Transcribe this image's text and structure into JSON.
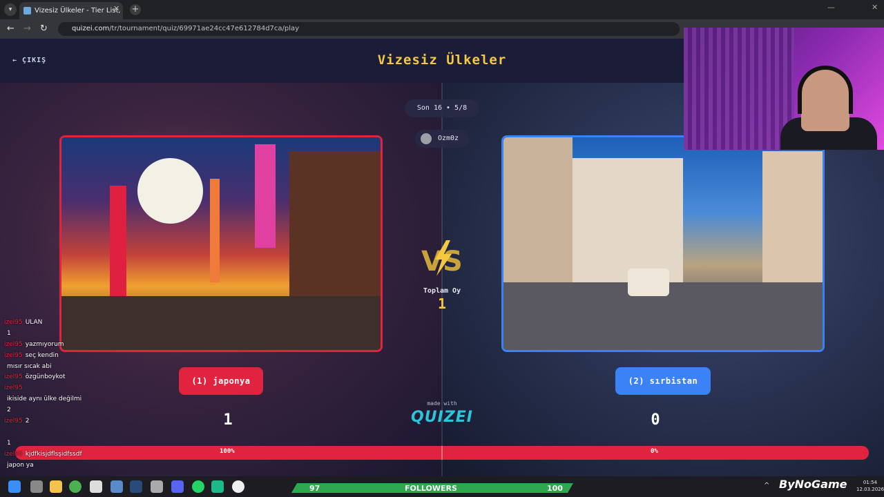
{
  "browser": {
    "tab_title": "Vizesiz Ülkeler - Tier List, Kör Se",
    "url_site": "quizei.com",
    "url_path": "/tr/tournament/quiz/69971ae24cc47e612784d7ca/play"
  },
  "header": {
    "exit_label": "ÇIKIŞ",
    "title": "Vizesiz Ülkeler"
  },
  "round": "Son 16 • 5/8",
  "user": "Ozm0z",
  "total": {
    "label": "Toplam Oy",
    "value": "1"
  },
  "left": {
    "choice": "(1) japonya",
    "count": "1",
    "percent": "100%",
    "image": "osaka-dotonbori-street"
  },
  "right": {
    "choice": "(2) sırbistan",
    "count": "0",
    "percent": "0%",
    "image": "belgrade-knez-mihailova-street"
  },
  "progress": {
    "left_fraction": 1.0
  },
  "brand": {
    "made_with": "made with",
    "name": "QUIZEI"
  },
  "chat": [
    {
      "user": "izel95",
      "msg": "ULAN"
    },
    {
      "user": "",
      "msg": "1"
    },
    {
      "user": "izel95",
      "msg": "yazmıyorum"
    },
    {
      "user": "izel95",
      "msg": "seç kendin"
    },
    {
      "user": "",
      "msg": "mısır sıcak abi"
    },
    {
      "user": "izel95",
      "msg": "özgünboykot"
    },
    {
      "user": "izel95",
      "msg": ""
    },
    {
      "user": "",
      "msg": "ikiside aynı ülke değilmi"
    },
    {
      "user": "",
      "msg": "2"
    },
    {
      "user": "izel95",
      "msg": "2"
    },
    {
      "user": "",
      "msg": ""
    },
    {
      "user": "",
      "msg": "1"
    },
    {
      "user": "izel95",
      "msg": "kjdfkisjdflsşidfssdf"
    },
    {
      "user": "",
      "msg": "japon ya"
    }
  ],
  "taskbar": {
    "followers_label": "FOLLOWERS",
    "followers_current": "97",
    "followers_goal": "100",
    "logo": "ByNoGame",
    "time": "01:54",
    "date": "12.03.2026"
  },
  "colors": {
    "accent_red": "#e0243f",
    "accent_blue": "#3b82f6",
    "title_gold": "#f5c842",
    "brand_cyan": "#2ec4d8"
  }
}
